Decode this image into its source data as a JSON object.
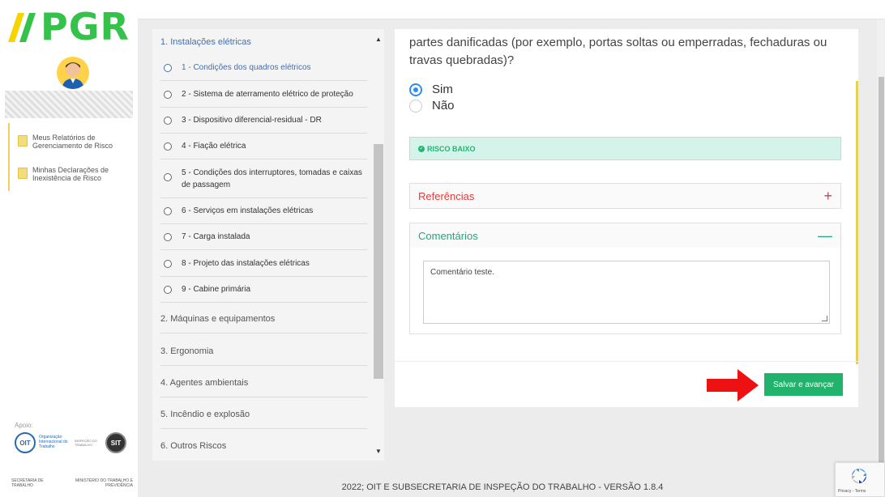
{
  "brand": {
    "logo_text": "PGR",
    "accent": "#35c24a"
  },
  "sidebar": {
    "links": [
      {
        "label": "Meus Relatórios de Gerenciamento de Risco",
        "icon": "document-icon"
      },
      {
        "label": "Minhas Declarações de Inexistência de Risco",
        "icon": "document-icon"
      }
    ],
    "apoio_label": "Apoio:",
    "partners": {
      "ilo": "OIT",
      "ilo_text": "Organização Internacional do Trabalho",
      "mid_text": "INSPEÇÃO DO TRABALHO",
      "sit": "SIT",
      "gov_left": "SECRETARIA DE TRABALHO",
      "gov_right": "MINISTÉRIO DO TRABALHO E PREVIDÊNCIA"
    }
  },
  "nav": {
    "sections": [
      {
        "label": "1. Instalações elétricas",
        "active": true
      },
      {
        "label": "2. Máquinas e equipamentos"
      },
      {
        "label": "3. Ergonomia"
      },
      {
        "label": "4. Agentes ambientais"
      },
      {
        "label": "5. Incêndio e explosão"
      },
      {
        "label": "6. Outros Riscos"
      }
    ],
    "items": [
      {
        "label": "1 - Condições dos quadros elétricos",
        "active": true
      },
      {
        "label": "2 - Sistema de aterramento elétrico de proteção"
      },
      {
        "label": "3 - Dispositivo diferencial-residual - DR"
      },
      {
        "label": "4 - Fiação elétrica"
      },
      {
        "label": "5 - Condições dos interruptores, tomadas e caixas de passagem"
      },
      {
        "label": "6 - Serviços em instalações elétricas"
      },
      {
        "label": "7 - Carga instalada"
      },
      {
        "label": "8 - Projeto das instalações elétricas"
      },
      {
        "label": "9 - Cabine primária"
      }
    ]
  },
  "question": {
    "text": "partes danificadas (por exemplo, portas soltas ou emperradas, fechaduras ou travas quebradas)?",
    "options": [
      {
        "label": "Sim",
        "checked": true
      },
      {
        "label": "Não",
        "checked": false
      }
    ],
    "risk_label": "RISCO BAIXO",
    "references_label": "Referências",
    "references_symbol": "+",
    "comments_label": "Comentários",
    "comments_symbol": "—",
    "comment_value": "Comentário teste.",
    "save_label": "Salvar e avançar"
  },
  "footer": {
    "text": "2022; OIT E SUBSECRETARIA DE INSPEÇÃO DO TRABALHO - VERSÃO 1.8.4"
  },
  "recaptcha": {
    "text": "Privacy - Terms"
  }
}
